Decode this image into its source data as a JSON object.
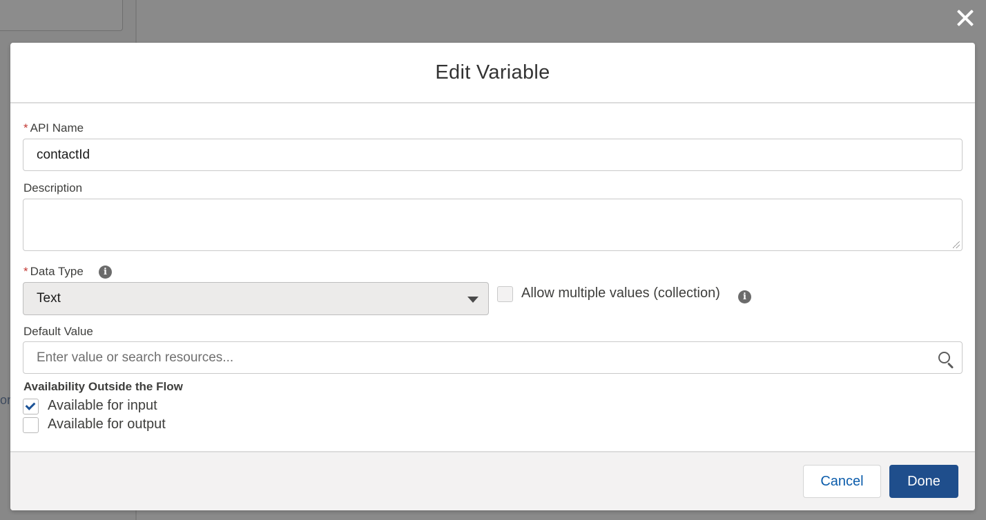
{
  "background": {
    "fragment_text": "on"
  },
  "modal": {
    "title": "Edit Variable",
    "api_name": {
      "label": "API Name",
      "required_marker": "*",
      "value": "contactId"
    },
    "description": {
      "label": "Description",
      "value": ""
    },
    "data_type": {
      "label": "Data Type",
      "required_marker": "*",
      "selected": "Text",
      "info_icon": "info-icon"
    },
    "allow_multiple": {
      "label": "Allow multiple values (collection)",
      "checked": false,
      "disabled": true,
      "info_icon": "info-icon"
    },
    "default_value": {
      "label": "Default Value",
      "placeholder": "Enter value or search resources...",
      "icon": "search-icon"
    },
    "availability": {
      "title": "Availability Outside the Flow",
      "input": {
        "label": "Available for input",
        "checked": true
      },
      "output": {
        "label": "Available for output",
        "checked": false
      }
    },
    "footer": {
      "cancel_label": "Cancel",
      "done_label": "Done"
    }
  },
  "colors": {
    "primary_button": "#1f4e8c",
    "link": "#0b5cab",
    "required": "#c23934",
    "overlay": "#8a8a8a"
  }
}
